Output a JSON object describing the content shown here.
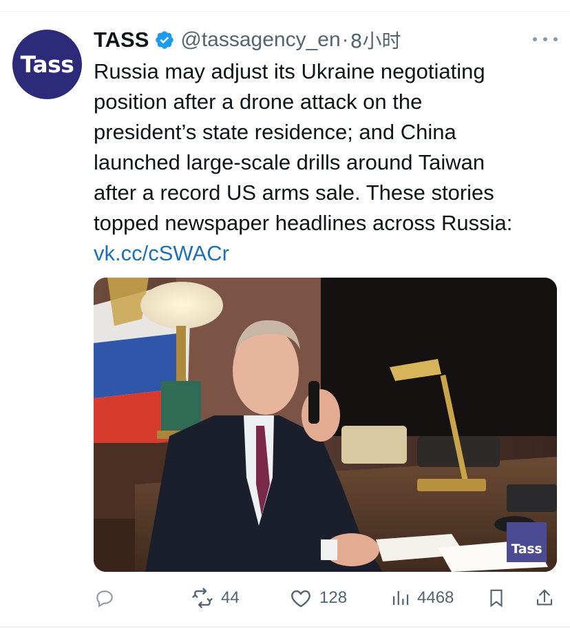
{
  "account": {
    "avatar_text": "Tass",
    "name": "TASS",
    "handle": "@tassagency_en",
    "separator": "·",
    "time": "8小时"
  },
  "tweet": {
    "lines": [
      "Russia may adjust its Ukraine negotiating",
      "position after a drone attack on the",
      "president’s state residence; and China",
      "launched large-scale drills around Taiwan",
      "after a record US arms sale. These stories",
      "topped newspaper headlines across Russia:"
    ],
    "link": "vk.cc/cSWACr"
  },
  "media": {
    "watermark_text": "Tass"
  },
  "actions": {
    "reply_icon": "reply-icon",
    "retweet_icon": "retweet-icon",
    "retweet_count": "44",
    "like_icon": "heart-icon",
    "like_count": "128",
    "views_icon": "views-icon",
    "views_count": "4468",
    "bookmark_icon": "bookmark-icon",
    "share_icon": "share-icon"
  },
  "colors": {
    "avatar_bg": "#2e2a7a",
    "verified": "#1d9bf0",
    "link": "#1d6fb8",
    "muted": "#536471"
  }
}
